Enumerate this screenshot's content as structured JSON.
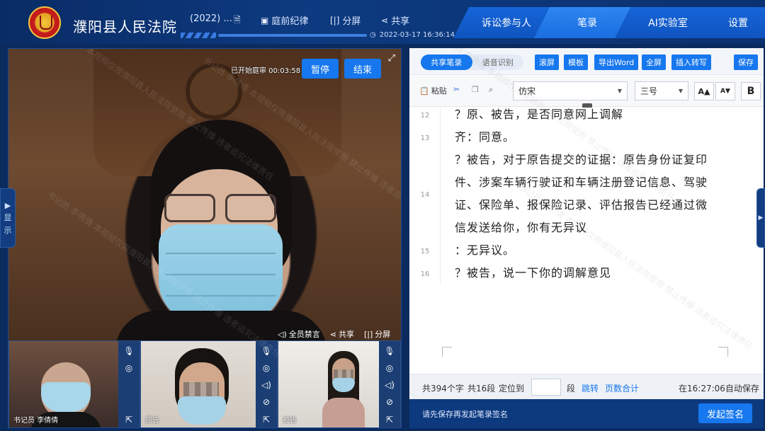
{
  "header": {
    "court_name": "濮阳县人民法院",
    "case_no": "(2022) ...",
    "tools": [
      {
        "label": "庭前纪律",
        "icon": "document-icon"
      },
      {
        "label": "分屏",
        "icon": "split-screen-icon"
      },
      {
        "label": "共享",
        "icon": "share-icon"
      }
    ],
    "datetime": "2022-03-17 16:36:14",
    "nav_tabs": [
      {
        "label": "诉讼参与人",
        "active": false
      },
      {
        "label": "笔录",
        "active": true
      },
      {
        "label": "AI实验室",
        "active": false
      },
      {
        "label": "设置",
        "active": false
      }
    ]
  },
  "video": {
    "elapsed_label": "已开始庭审 00:03:58",
    "pause_label": "暂停",
    "end_label": "结束",
    "toolbar": {
      "mute_all": "全员禁言",
      "share": "共享",
      "split": "分屏"
    },
    "thumbs": [
      {
        "label": "书记员 李倩倩"
      },
      {
        "label": "原告"
      },
      {
        "label": "被告"
      }
    ]
  },
  "side_tab_left": {
    "chars": [
      "显",
      "示"
    ]
  },
  "record": {
    "mode_tabs": [
      "共享笔录",
      "语音识别"
    ],
    "buttons": [
      "滚屏",
      "模板",
      "导出Word",
      "全屏",
      "插入转写",
      "保存"
    ],
    "editor_toolbar": {
      "paste": "粘贴",
      "font": "仿宋",
      "size": "三号",
      "grow": "A▲",
      "shrink": "A▼",
      "bold": "B"
    },
    "lines": [
      {
        "no": "12",
        "text": "？原、被告，是否同意网上调解"
      },
      {
        "no": "13",
        "text": "齐：同意。"
      },
      {
        "no": "14",
        "text": "？被告，对于原告提交的证据：原告身份证复印件、涉案车辆行驶证和车辆注册登记信息、驾驶证、保险单、报保险记录、评估报告已经通过微信发送给你，你有无异议"
      },
      {
        "no": "15",
        "text": "：无异议。"
      },
      {
        "no": "16",
        "text": "？被告，说一下你的调解意见"
      }
    ],
    "status": {
      "char_count": "共394个字",
      "para_count": "共16段",
      "goto_label": "定位到",
      "para_unit": "段",
      "jump": "跳转",
      "page_total": "页数合计",
      "autosave": "在16:27:06自动保存"
    },
    "sign_hint": "请先保存再发起笔录签名",
    "sign_button": "发起签名"
  },
  "watermark": "书记员 李倩倩 本视频仅限濮阳县人民法院使用 禁止传播 违者追究法律责任"
}
